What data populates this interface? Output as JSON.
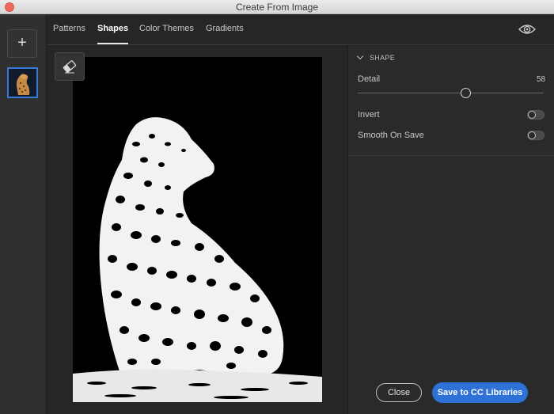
{
  "window": {
    "title": "Create From Image"
  },
  "tabs": [
    {
      "label": "Patterns"
    },
    {
      "label": "Shapes"
    },
    {
      "label": "Color Themes"
    },
    {
      "label": "Gradients"
    }
  ],
  "leftbar": {
    "add_label": "+"
  },
  "panel": {
    "section_title": "SHAPE",
    "detail_label": "Detail",
    "detail_value": "58",
    "detail_fraction": 0.58,
    "invert_label": "Invert",
    "invert_on": false,
    "smooth_label": "Smooth On Save",
    "smooth_on": false
  },
  "footer": {
    "close_label": "Close",
    "save_label": "Save to CC Libraries"
  },
  "colors": {
    "accent": "#2e72d8",
    "background": "#262626",
    "panel": "#2a2a2a"
  }
}
